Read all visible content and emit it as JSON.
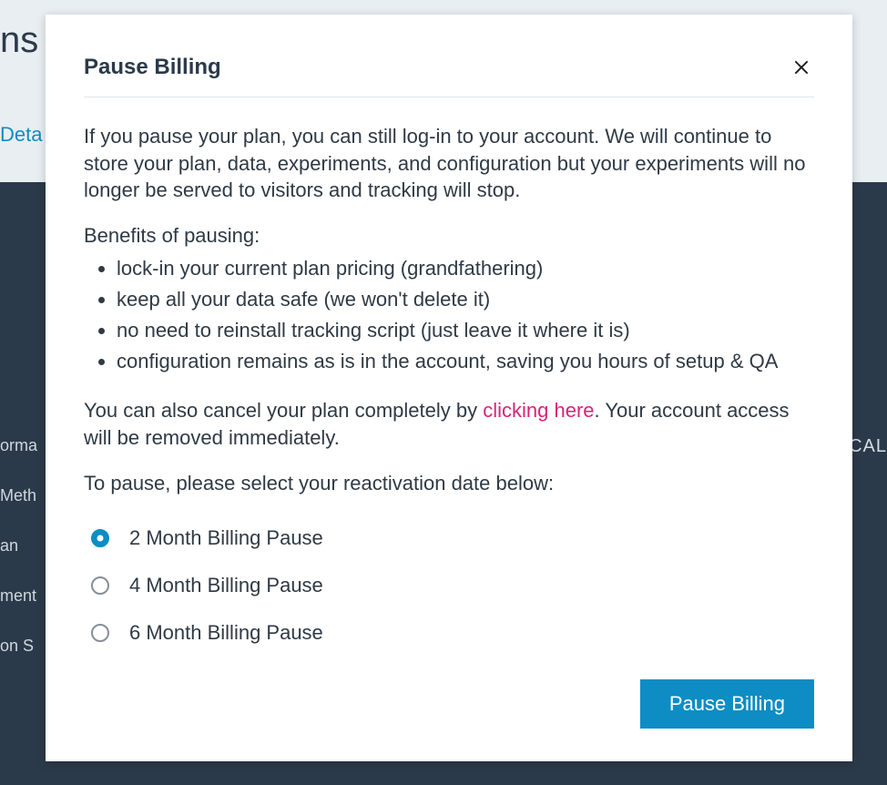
{
  "background": {
    "heading_fragment": "ns &",
    "tab": "Deta",
    "side_items": [
      "orma",
      "Meth",
      "an",
      "ment",
      "on S"
    ],
    "right_fragment": "CAL"
  },
  "modal": {
    "title": "Pause Billing",
    "intro": "If you pause your plan, you can still log-in to your account. We will continue to store your plan, data, experiments, and configuration but your experiments will no longer be served to visitors and tracking will stop.",
    "benefits_heading": "Benefits of pausing:",
    "benefits": [
      "lock-in your current plan pricing (grandfathering)",
      "keep all your data safe (we won't delete it)",
      "no need to reinstall tracking script (just leave it where it is)",
      "configuration remains as is in the account, saving you hours of setup & QA"
    ],
    "cancel_prefix": "You can also cancel your plan completely by ",
    "cancel_link": "clicking here",
    "cancel_suffix": ". Your account access will be removed immediately.",
    "select_text": "To pause, please select your reactivation date below:",
    "options": [
      {
        "label": "2 Month Billing Pause",
        "selected": true
      },
      {
        "label": "4 Month Billing Pause",
        "selected": false
      },
      {
        "label": "6 Month Billing Pause",
        "selected": false
      }
    ],
    "submit_label": "Pause Billing"
  }
}
